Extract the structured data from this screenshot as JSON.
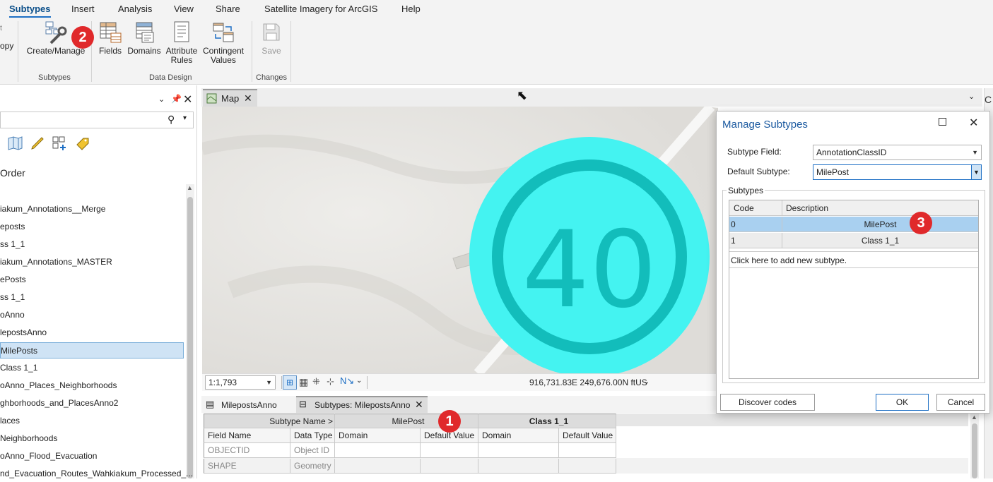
{
  "ribbon": {
    "tabs": [
      "Subtypes",
      "Insert",
      "Analysis",
      "View",
      "Share",
      "Satellite Imagery for ArcGIS",
      "Help"
    ],
    "left_fragments": [
      "t",
      "opy"
    ],
    "buttons": {
      "create_manage": "Create/Manage",
      "fields": "Fields",
      "domains": "Domains",
      "attribute_rules": "Attribute Rules",
      "contingent_values": "Contingent Values",
      "save": "Save"
    },
    "groups": {
      "subtypes": "Subtypes",
      "data_design": "Data Design",
      "changes": "Changes"
    }
  },
  "badges": {
    "one": "1",
    "two": "2",
    "three": "3"
  },
  "contents": {
    "heading": "Order",
    "layers": [
      "iakum_Annotations__Merge",
      "eposts",
      "ss 1_1",
      "iakum_Annotations_MASTER",
      "ePosts",
      "ss 1_1",
      "oAnno",
      "lepostsAnno",
      "MilePosts",
      "Class 1_1",
      "oAnno_Places_Neighborhoods",
      "ghborhoods_and_PlacesAnno2",
      "laces",
      "Neighborhoods",
      "oAnno_Flood_Evacuation",
      "nd_Evacuation_Routes_Wahkiakum_Processed_..."
    ],
    "selected_index": 8
  },
  "map": {
    "tab_label": "Map",
    "symbol_number": "40",
    "scale": "1:1,793",
    "coordinates": "916,731.83E 249,676.00N ftUS"
  },
  "bottom": {
    "tabs": [
      "MilepostsAnno",
      "Subtypes: MilepostsAnno"
    ],
    "subtype_name_header": "Subtype Name >",
    "subtype1": "MilePost",
    "subtype2": "Class 1_1",
    "columns": [
      "Field Name",
      "Data Type",
      "Domain",
      "Default Value",
      "Domain",
      "Default Value"
    ],
    "rows": [
      [
        "OBJECTID",
        "Object ID"
      ],
      [
        "SHAPE",
        "Geometry"
      ]
    ]
  },
  "dialog": {
    "title": "Manage Subtypes",
    "subtype_field_label": "Subtype Field:",
    "subtype_field_value": "AnnotationClassID",
    "default_subtype_label": "Default Subtype:",
    "default_subtype_value": "MilePost",
    "group_label": "Subtypes",
    "col_code": "Code",
    "col_description": "Description",
    "rows": [
      {
        "code": "0",
        "description": "MilePost"
      },
      {
        "code": "1",
        "description": "Class 1_1"
      }
    ],
    "add_row": "Click here to add new subtype.",
    "discover": "Discover codes",
    "ok": "OK",
    "cancel": "Cancel"
  },
  "colors": {
    "accent": "#1c6ec4",
    "badge": "#e0292b",
    "symbol_fill": "#44f3f1",
    "symbol_ring": "#12bdbb",
    "selection": "#a9d0f0"
  }
}
